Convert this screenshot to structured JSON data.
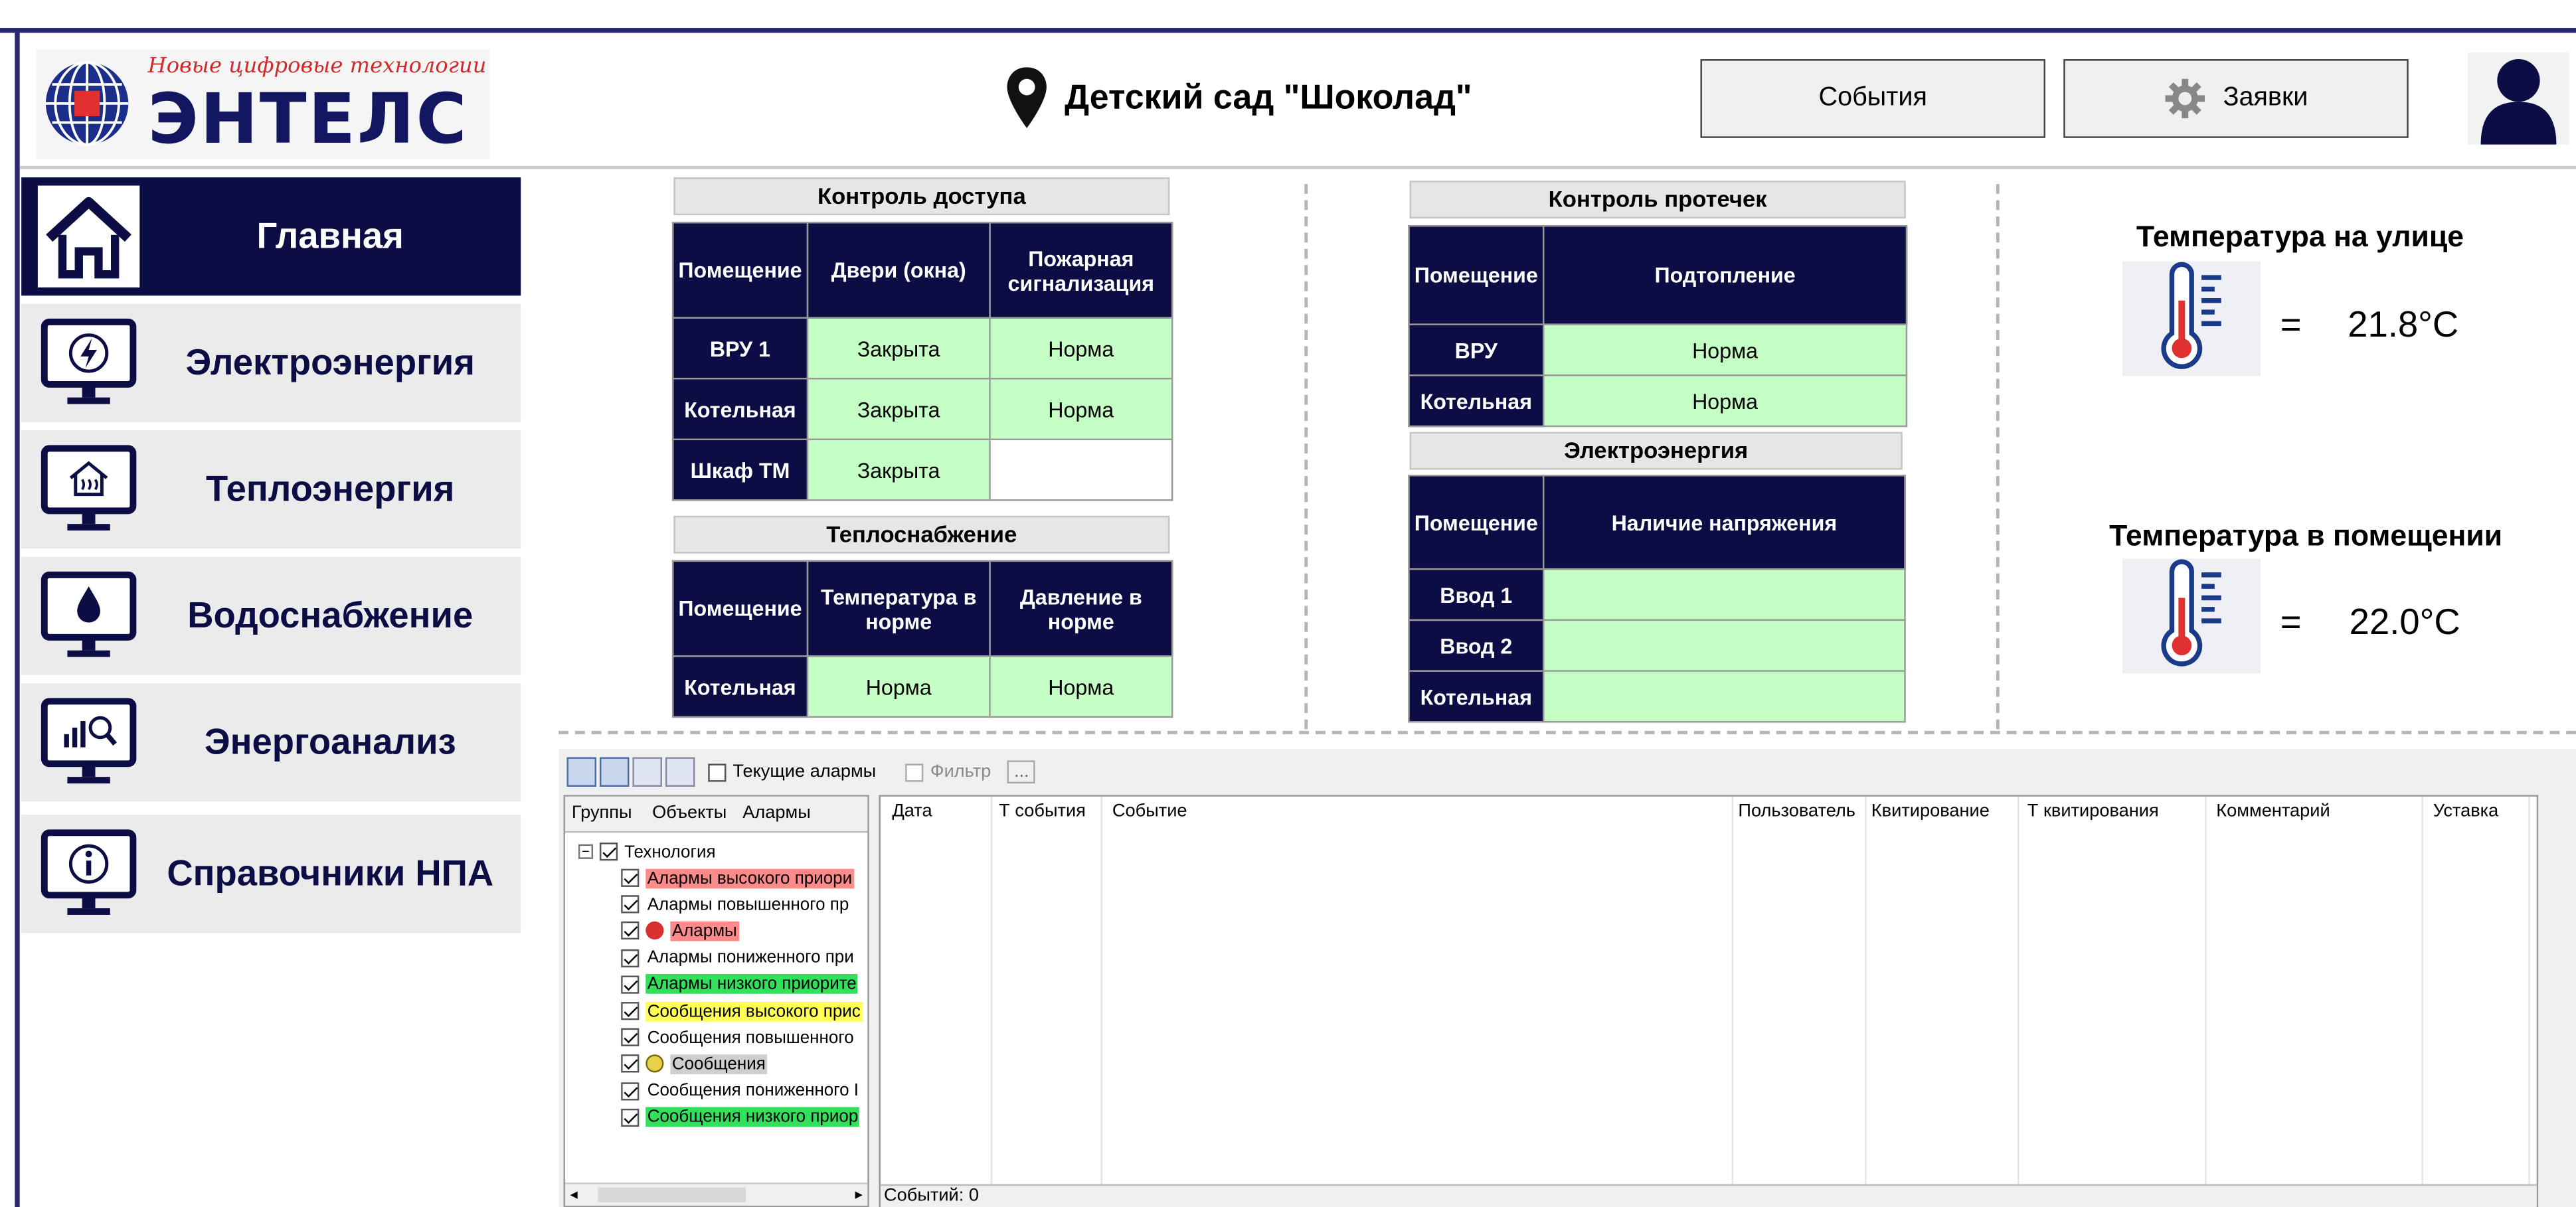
{
  "header": {
    "logo_tagline": "Новые цифровые технологии",
    "logo_name": "ЭНТЕЛС",
    "location_icon": "map-pin-icon",
    "location_title": "Детский сад \"Шоколад\"",
    "events_button": "События",
    "requests_button": "Заявки",
    "requests_icon": "gear-icon",
    "user_icon": "user-icon"
  },
  "sidebar": {
    "items": [
      {
        "label": "Главная",
        "icon": "home-icon",
        "active": true
      },
      {
        "label": "Электроэнергия",
        "icon": "lightning-monitor-icon"
      },
      {
        "label": "Теплоэнергия",
        "icon": "heat-monitor-icon"
      },
      {
        "label": "Водоснабжение",
        "icon": "water-drop-monitor-icon"
      },
      {
        "label": "Энергоанализ",
        "icon": "energy-analysis-monitor-icon"
      },
      {
        "label": "Справочники НПА",
        "icon": "info-monitor-icon"
      }
    ]
  },
  "access": {
    "title": "Контроль доступа",
    "headers": [
      "Помещение",
      "Двери (окна)",
      "Пожарная сигнализация"
    ],
    "rows": [
      [
        "ВРУ 1",
        "Закрыта",
        "Норма"
      ],
      [
        "Котельная",
        "Закрыта",
        "Норма"
      ],
      [
        "Шкаф ТМ",
        "Закрыта",
        ""
      ]
    ]
  },
  "heat": {
    "title": "Теплоснабжение",
    "headers": [
      "Помещение",
      "Температура в норме",
      "Давление в норме"
    ],
    "rows": [
      [
        "Котельная",
        "Норма",
        "Норма"
      ]
    ]
  },
  "leaks": {
    "title": "Контроль протечек",
    "headers": [
      "Помещение",
      "Подтопление"
    ],
    "rows": [
      [
        "ВРУ",
        "Норма"
      ],
      [
        "Котельная",
        "Норма"
      ]
    ]
  },
  "power": {
    "title": "Электроэнергия",
    "headers": [
      "Помещение",
      "Наличие напряжения"
    ],
    "rows": [
      [
        "Ввод 1",
        ""
      ],
      [
        "Ввод 2",
        ""
      ],
      [
        "Котельная",
        ""
      ]
    ]
  },
  "temperature": {
    "outside_title": "Температура на улице",
    "outside_eq": "=",
    "outside_value": "21.8°C",
    "inside_title": "Температура в помещении",
    "inside_eq": "=",
    "inside_value": "22.0°C",
    "icon": "thermometer-icon"
  },
  "alarms": {
    "toolbar": {
      "current_alarms": "Текущие алармы",
      "current_alarms_checked": false,
      "filter": "Фильтр",
      "more": "..."
    },
    "tabs": [
      "Группы",
      "Объекты",
      "Алармы"
    ],
    "tree_root": "Технология",
    "tree_items": [
      {
        "label": "Алармы высокого приори",
        "color": "#ff8a8a"
      },
      {
        "label": "Алармы повышенного пр",
        "color": ""
      },
      {
        "label": "Алармы",
        "color": "#ff8a8a",
        "icon": "alarm-icon"
      },
      {
        "label": "Алармы пониженного при",
        "color": ""
      },
      {
        "label": "Алармы низкого приорите",
        "color": "#33e05a"
      },
      {
        "label": "Сообщения высокого прис",
        "color": "#ffff55"
      },
      {
        "label": "Сообщения повышенного",
        "color": ""
      },
      {
        "label": "Сообщения",
        "color": "#cfcfcf",
        "icon": "message-icon"
      },
      {
        "label": "Сообщения пониженного I",
        "color": ""
      },
      {
        "label": "Сообщения низкого приор",
        "color": "#33e05a"
      }
    ],
    "columns": [
      "Дата",
      "Т события",
      "Событие",
      "Пользователь",
      "Квитирование",
      "Т квитирования",
      "Комментарий",
      "Уставка"
    ],
    "status": "Событий: 0"
  }
}
